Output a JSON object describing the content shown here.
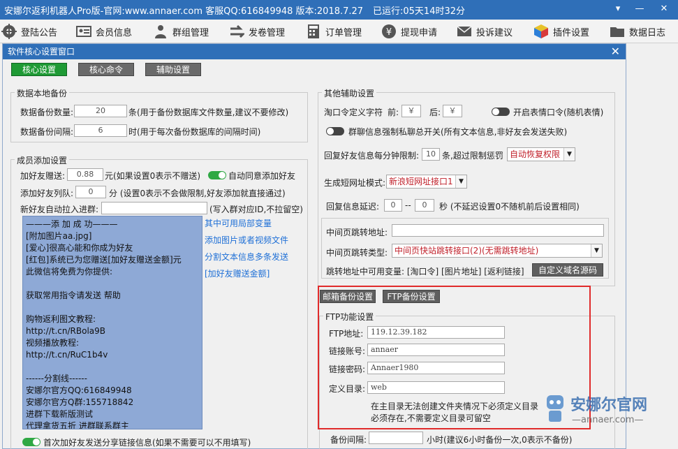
{
  "titlebar": {
    "title": "安娜尔返利机器人Pro版-官网:www.annaer.com 客服QQ:616849948  版本:2018.7.27",
    "runtime": "已运行:05天14时32分",
    "menu_btn": "▾",
    "minimize_btn": "—",
    "close_btn": "✕"
  },
  "toolbar": {
    "items": [
      {
        "label": "登陆公告",
        "icon": "gear-icon"
      },
      {
        "label": "会员信息",
        "icon": "id-card-icon"
      },
      {
        "label": "群组管理",
        "icon": "group-icon"
      },
      {
        "label": "发卷管理",
        "icon": "arrows-icon"
      },
      {
        "label": "订单管理",
        "icon": "calculator-icon"
      },
      {
        "label": "提现申请",
        "icon": "yen-icon"
      },
      {
        "label": "投诉建议",
        "icon": "mail-icon"
      },
      {
        "label": "插件设置",
        "icon": "cube-icon"
      },
      {
        "label": "数据日志",
        "icon": "folder-icon"
      }
    ]
  },
  "window": {
    "title": "软件核心设置窗口",
    "close": "✕",
    "tabs": [
      "核心设置",
      "核心命令",
      "辅助设置"
    ]
  },
  "backup": {
    "title": "数据本地备份",
    "count_label": "数据备份数量:",
    "count_value": "20",
    "count_note": "条(用于备份数据库文件数量,建议不要修改)",
    "interval_label": "数据备份间隔:",
    "interval_value": "6",
    "interval_note": "时(用于每次备份数据库的间隔时间)"
  },
  "member": {
    "title": "成员添加设置",
    "gift_label": "加好友赠送:",
    "gift_value": "0.88",
    "gift_note": "元(如果设置0表示不赠送)",
    "auto_agree": "自动同意添加好友",
    "queue_label": "添加好友列队:",
    "queue_value": "0",
    "queue_note": "分 (设置0表示不会做限制,好友添加就直接通过)",
    "pull_label": "新好友自动拉入进群:",
    "pull_note": "(写入群对应ID,不拉留空)",
    "message_lines": [
      "———添 加 成 功———",
      "[附加图片aa.jpg]",
      "[爱心]很高心能和你成为好友",
      "[红包]系统已为您赠送[加好友赠送金额]元",
      "此微信将免费为你提供:",
      "",
      "获取常用指令请发送  帮助",
      "",
      "购物返利图文教程:",
      "http://t.cn/RBola9B",
      "视频播放教程:",
      "http://t.cn/RuC1b4v",
      "",
      "------分割线------",
      "安娜尔官方QQ:616849948",
      "安娜尔官方Q群:155718842",
      "进群下载新版测试",
      "代理拿货五折 进群联系群主"
    ],
    "links": [
      "其中可用局部变量",
      "添加图片或者视频文件",
      "分割文本信息多条发送",
      "[加好友赠送金额]"
    ],
    "share_label": "首次加好友发送分享链接信息(如果不需要可以不用填写)"
  },
  "other": {
    "title": "其他辅助设置",
    "taokou_label": "淘口令定义字符",
    "front_label": "前:",
    "front_value": "￥",
    "back_label": "后:",
    "back_value": "￥",
    "emoji_label": "开启表情口令(随机表情)",
    "group_private": "群聊信息强制私聊总开关(所有文本信息,非好友会发送失败)",
    "reply_limit_label": "回复好友信息每分钟限制:",
    "reply_limit_value": "10",
    "reply_limit_note": "条,超过限制惩罚",
    "punish_value": "自动恢复权限",
    "shorturl_label": "生成短网址模式:",
    "shorturl_value": "新浪短网址接口1",
    "delay_label": "回复信息延迟:",
    "delay_from": "0",
    "delay_sep": "--",
    "delay_to": "0",
    "delay_note": "秒 (不延迟设置0不随机前后设置相同)",
    "mid_page_label": "中间页跳转地址:",
    "mid_type_label": "中间页跳转类型:",
    "mid_type_value": "中间页快站跳转接口(2)(无需跳转地址)",
    "jump_vars": "跳转地址中可用变量: [淘口令] [图片地址] [返利链接]",
    "custom_domain_btn": "自定义域名源码"
  },
  "backup_tabs": [
    "邮箱备份设置",
    "FTP备份设置"
  ],
  "ftp": {
    "title": "FTP功能设置",
    "addr_label": "FTP地址:",
    "addr_value": "119.12.39.182",
    "user_label": "链接账号:",
    "user_value": "annaer",
    "pass_label": "链接密码:",
    "pass_value": "Annaer1980",
    "dir_label": "定义目录:",
    "dir_value": "web",
    "note1": "在主目录无法创建文件夹情况下必须定义目录",
    "note2": "必须存在,不需要定义目录可留空",
    "interval_label": "备份间隔:",
    "interval_note": "小时(建议6小时备份一次,0表示不备份)"
  },
  "watermark": {
    "brand": "安娜尔官网",
    "url": "—annaer.com—"
  },
  "colors": {
    "title_blue": "#2f6fb8",
    "tab_green": "#1f9a35",
    "tab_grey": "#6a6a6a",
    "list_blue": "#8ea9d6",
    "link_blue": "#1e6fd6",
    "select_red": "#c0202a",
    "highlight_red": "#e02a2a"
  }
}
